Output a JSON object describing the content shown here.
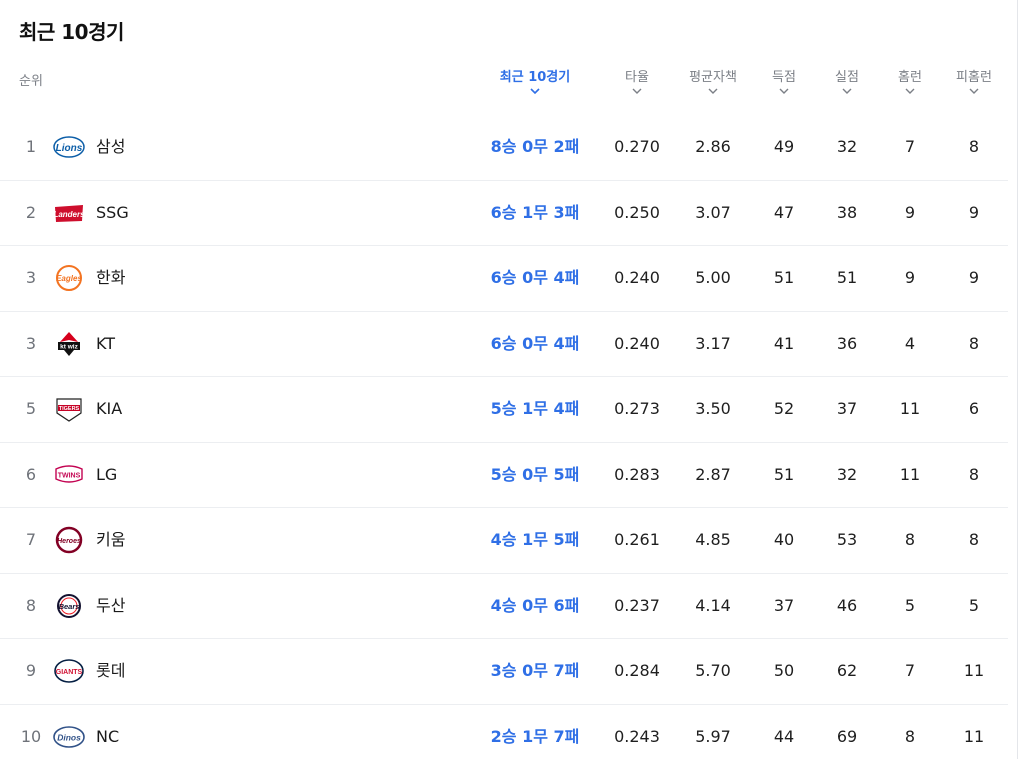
{
  "title": "최근 10경기",
  "header": {
    "rank": "순위",
    "record": "최근 10경기",
    "avg": "타율",
    "era": "평균자책",
    "runs_scored": "득점",
    "runs_allowed": "실점",
    "home_runs": "홈런",
    "home_runs_allowed": "피홈런"
  },
  "colors": {
    "accent": "#2f6fe6",
    "muted": "#7b7f86",
    "divider": "#eceef1"
  },
  "rows": [
    {
      "rank": "1",
      "logo": "lions-logo-icon",
      "team": "삼성",
      "record": "8승 0무 2패",
      "avg": "0.270",
      "era": "2.86",
      "rs": "49",
      "ra": "32",
      "hr": "7",
      "hra": "8"
    },
    {
      "rank": "2",
      "logo": "landers-logo-icon",
      "team": "SSG",
      "record": "6승 1무 3패",
      "avg": "0.250",
      "era": "3.07",
      "rs": "47",
      "ra": "38",
      "hr": "9",
      "hra": "9"
    },
    {
      "rank": "3",
      "logo": "eagles-logo-icon",
      "team": "한화",
      "record": "6승 0무 4패",
      "avg": "0.240",
      "era": "5.00",
      "rs": "51",
      "ra": "51",
      "hr": "9",
      "hra": "9"
    },
    {
      "rank": "3",
      "logo": "ktwiz-logo-icon",
      "team": "KT",
      "record": "6승 0무 4패",
      "avg": "0.240",
      "era": "3.17",
      "rs": "41",
      "ra": "36",
      "hr": "4",
      "hra": "8"
    },
    {
      "rank": "5",
      "logo": "tigers-logo-icon",
      "team": "KIA",
      "record": "5승 1무 4패",
      "avg": "0.273",
      "era": "3.50",
      "rs": "52",
      "ra": "37",
      "hr": "11",
      "hra": "6"
    },
    {
      "rank": "6",
      "logo": "twins-logo-icon",
      "team": "LG",
      "record": "5승 0무 5패",
      "avg": "0.283",
      "era": "2.87",
      "rs": "51",
      "ra": "32",
      "hr": "11",
      "hra": "8"
    },
    {
      "rank": "7",
      "logo": "heroes-logo-icon",
      "team": "키움",
      "record": "4승 1무 5패",
      "avg": "0.261",
      "era": "4.85",
      "rs": "40",
      "ra": "53",
      "hr": "8",
      "hra": "8"
    },
    {
      "rank": "8",
      "logo": "bears-logo-icon",
      "team": "두산",
      "record": "4승 0무 6패",
      "avg": "0.237",
      "era": "4.14",
      "rs": "37",
      "ra": "46",
      "hr": "5",
      "hra": "5"
    },
    {
      "rank": "9",
      "logo": "giants-logo-icon",
      "team": "롯데",
      "record": "3승 0무 7패",
      "avg": "0.284",
      "era": "5.70",
      "rs": "50",
      "ra": "62",
      "hr": "7",
      "hra": "11"
    },
    {
      "rank": "10",
      "logo": "dinos-logo-icon",
      "team": "NC",
      "record": "2승 1무 7패",
      "avg": "0.243",
      "era": "5.97",
      "rs": "44",
      "ra": "69",
      "hr": "8",
      "hra": "11"
    }
  ]
}
